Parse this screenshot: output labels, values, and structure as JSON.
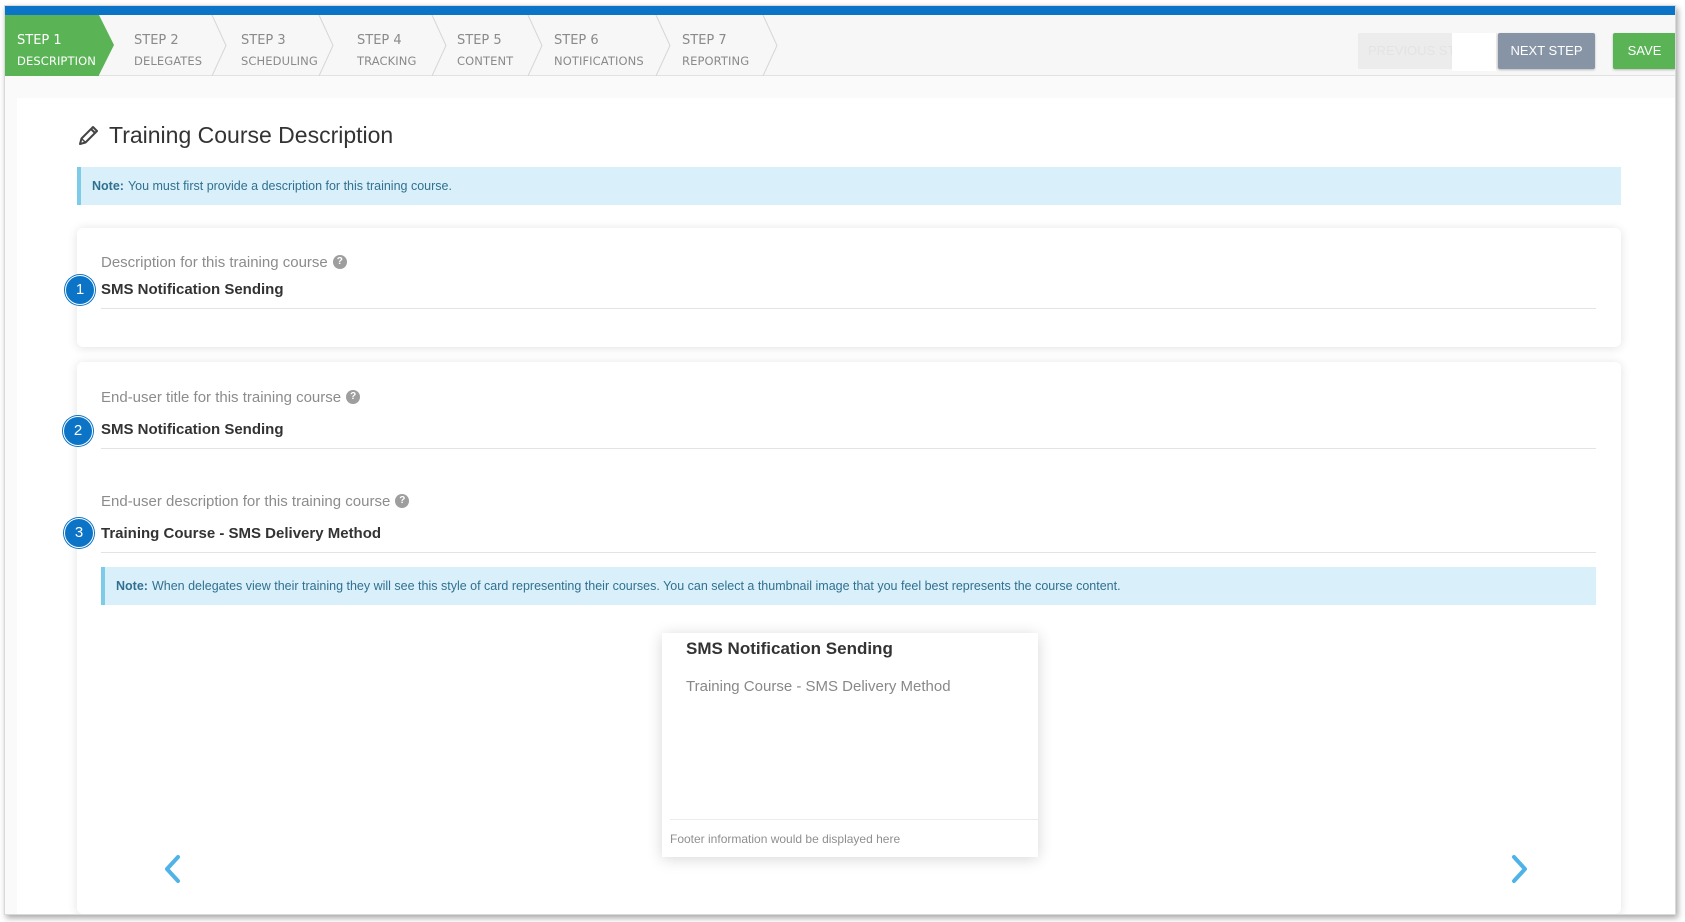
{
  "wizard": {
    "steps": [
      {
        "num": "STEP 1",
        "label": "DESCRIPTION"
      },
      {
        "num": "STEP 2",
        "label": "DELEGATES"
      },
      {
        "num": "STEP 3",
        "label": "SCHEDULING"
      },
      {
        "num": "STEP 4",
        "label": "TRACKING"
      },
      {
        "num": "STEP 5",
        "label": "CONTENT"
      },
      {
        "num": "STEP 6",
        "label": "NOTIFICATIONS"
      },
      {
        "num": "STEP 7",
        "label": "REPORTING"
      }
    ],
    "active_step": 1,
    "previous_label": "PREVIOUS ST",
    "next_label": "NEXT STEP",
    "save_label": "SAVE"
  },
  "page": {
    "title": "Training Course Description",
    "title_icon": "pencil-icon"
  },
  "top_note": {
    "label": "Note:",
    "text": "You must first provide a description for this training course."
  },
  "fields": {
    "description": {
      "badge": "1",
      "label": "Description for this training course",
      "value": "SMS Notification Sending"
    },
    "enduser_title": {
      "badge": "2",
      "label": "End-user title for this training course",
      "value": "SMS Notification Sending"
    },
    "enduser_description": {
      "badge": "3",
      "label": "End-user description for this training course",
      "value": "Training Course - SMS Delivery Method"
    }
  },
  "card_note": {
    "label": "Note:",
    "text": "When delegates view their training they will see this style of card representing their courses. You can select a thumbnail image that you feel best represents the course content."
  },
  "preview_card": {
    "title": "SMS Notification Sending",
    "description": "Training Course - SMS Delivery Method",
    "footer": "Footer information would be displayed here"
  },
  "help_glyph": "?",
  "colors": {
    "primary_blue": "#0c74c7",
    "step_active_green": "#5ab456",
    "save_green": "#5ab456",
    "next_gray": "#8794a6",
    "note_bg": "#d9f0fb",
    "carousel_arrow": "#4fb3e8"
  }
}
